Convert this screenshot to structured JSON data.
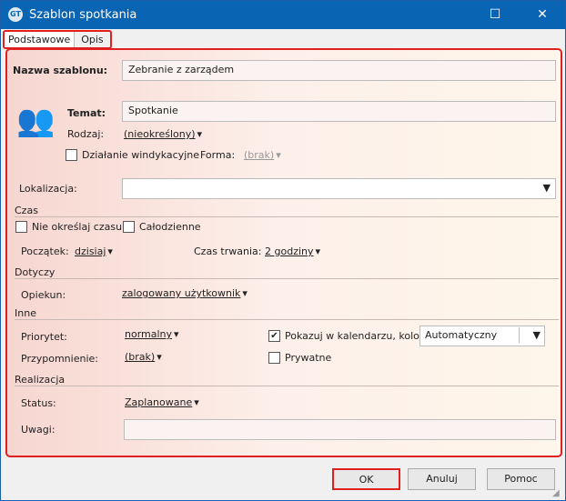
{
  "window": {
    "title": "Szablon spotkania",
    "logo": "GT"
  },
  "tabs": [
    "Podstawowe",
    "Opis"
  ],
  "form": {
    "nazwa_label": "Nazwa szablonu:",
    "nazwa_value": "Zebranie z zarządem",
    "temat_label": "Temat:",
    "temat_value": "Spotkanie",
    "rodzaj_label": "Rodzaj:",
    "rodzaj_value": "(nieokreślony)",
    "windykacyjne_label": "Działanie windykacyjne",
    "forma_label": "Forma:",
    "forma_value": "(brak)",
    "lokalizacja_label": "Lokalizacja:",
    "lokalizacja_value": ""
  },
  "czas": {
    "section": "Czas",
    "nie_okreslaj": "Nie określaj czasu",
    "calodzienne": "Całodzienne",
    "poczatek_label": "Początek:",
    "poczatek_value": "dzisiaj",
    "trwanie_label": "Czas trwania:",
    "trwanie_value": "2 godziny"
  },
  "dotyczy": {
    "section": "Dotyczy",
    "opiekun_label": "Opiekun:",
    "opiekun_value": "zalogowany użytkownik"
  },
  "inne": {
    "section": "Inne",
    "priorytet_label": "Priorytet:",
    "priorytet_value": "normalny",
    "pokazuj_label": "Pokazuj w kalendarzu, kolor:",
    "pokazuj_checked": true,
    "kolor_value": "Automatyczny",
    "przypomnienie_label": "Przypomnienie:",
    "przypomnienie_value": "(brak)",
    "prywatne_label": "Prywatne",
    "prywatne_checked": false
  },
  "realizacja": {
    "section": "Realizacja",
    "status_label": "Status:",
    "status_value": "Zaplanowane",
    "uwagi_label": "Uwagi:",
    "uwagi_value": ""
  },
  "buttons": {
    "ok": "OK",
    "cancel": "Anuluj",
    "help": "Pomoc"
  }
}
